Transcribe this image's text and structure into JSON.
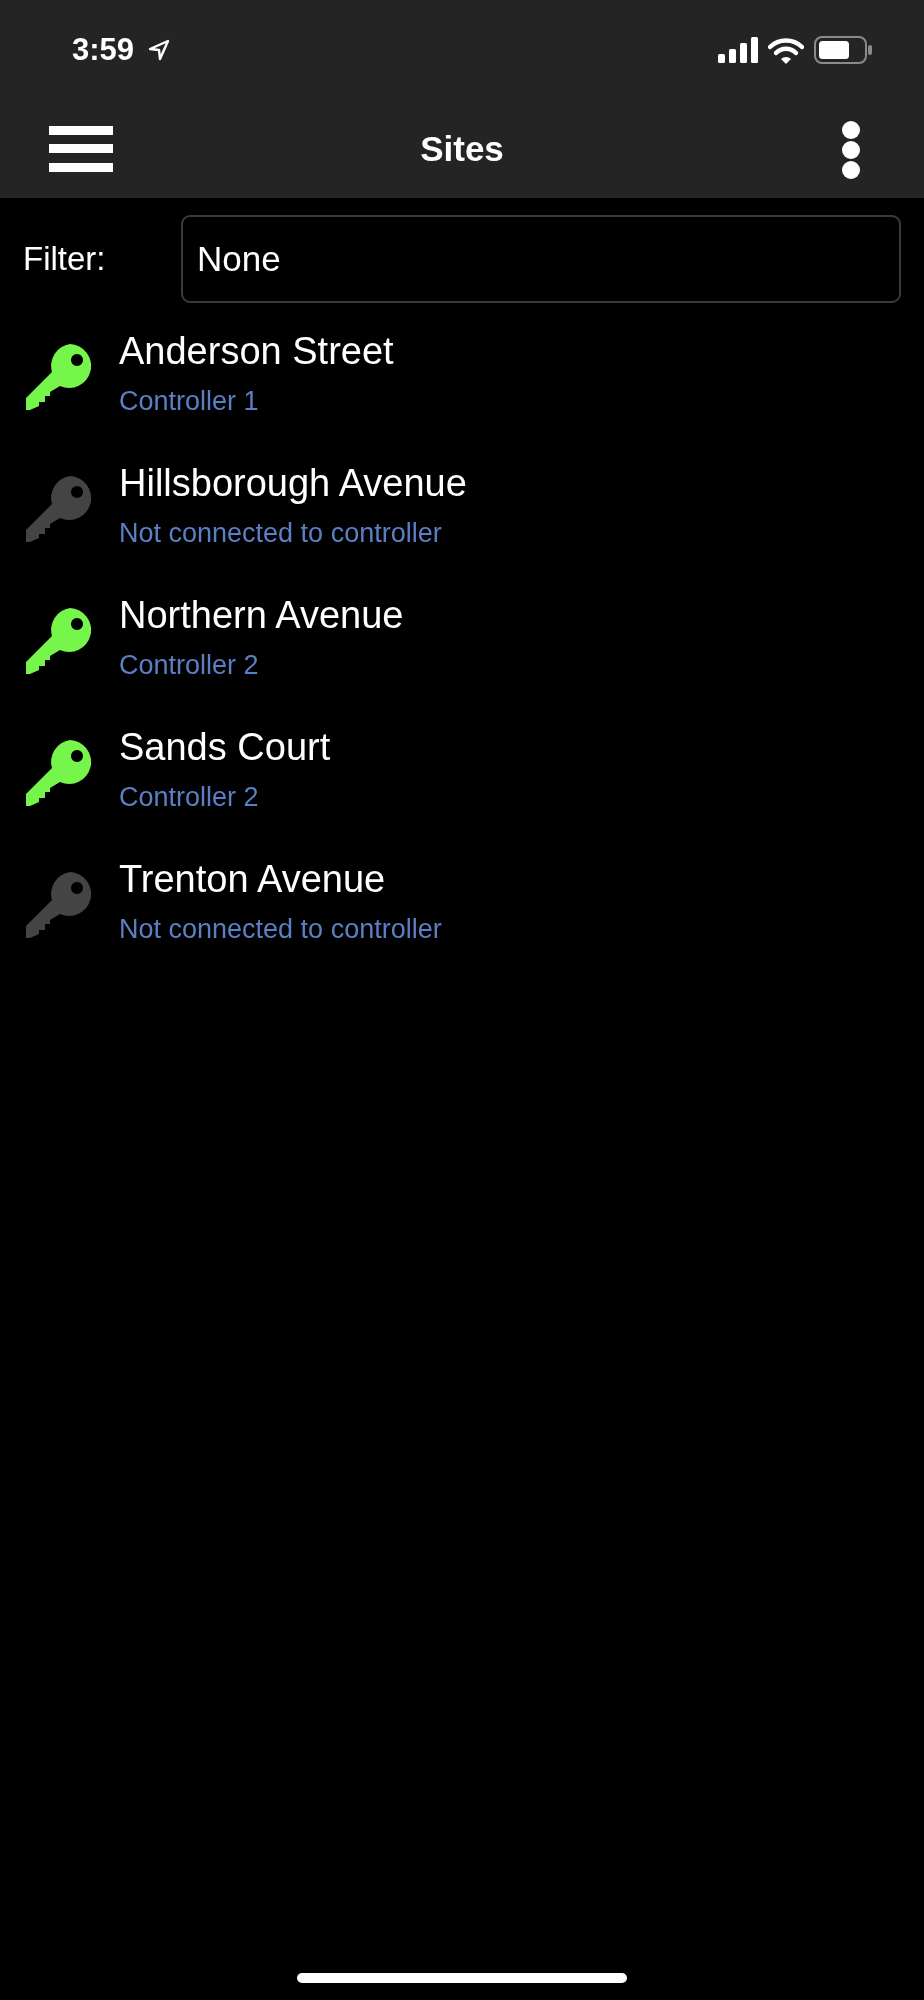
{
  "status_bar": {
    "time": "3:59"
  },
  "header": {
    "title": "Sites"
  },
  "filter": {
    "label": "Filter:",
    "value": "None"
  },
  "sites": [
    {
      "name": "Anderson Street",
      "status": "Controller 1",
      "connected": true
    },
    {
      "name": "Hillsborough Avenue",
      "status": "Not connected to controller",
      "connected": false
    },
    {
      "name": "Northern Avenue",
      "status": "Controller 2",
      "connected": true
    },
    {
      "name": "Sands Court",
      "status": "Controller 2",
      "connected": true
    },
    {
      "name": "Trenton Avenue",
      "status": "Not connected to controller",
      "connected": false
    }
  ]
}
